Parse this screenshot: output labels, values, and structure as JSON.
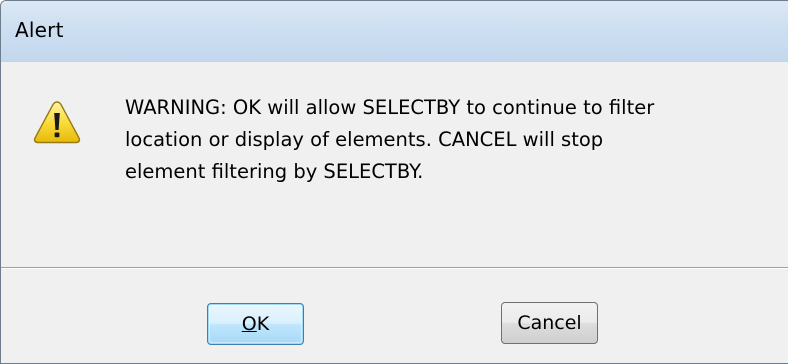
{
  "dialog": {
    "title": "Alert",
    "message": "WARNING: OK will allow SELECTBY to continue to filter\nlocation or display of elements. CANCEL will stop\nelement filtering by SELECTBY.",
    "icon": "warning-icon"
  },
  "buttons": {
    "ok_label_mnemonic": "O",
    "ok_label_rest": "K",
    "cancel_label": "Cancel"
  },
  "colors": {
    "titlebar": "#cddff1",
    "client_background": "#f0f0f0",
    "warning_yellow": "#f7d21a",
    "default_button_border": "#3c7fb1"
  }
}
